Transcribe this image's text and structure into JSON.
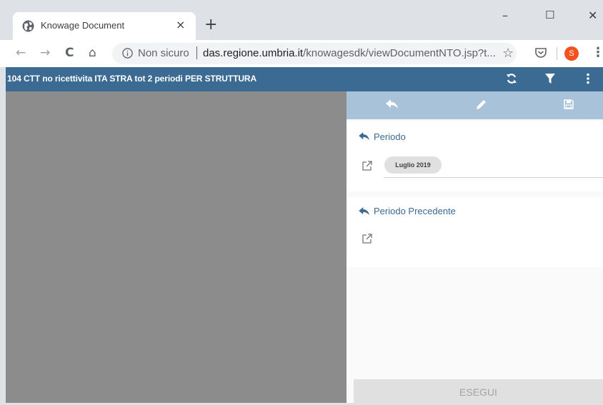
{
  "browser": {
    "tab_title": "Knowage Document",
    "tab_close": "×",
    "new_tab": "+",
    "window_controls": {
      "minimize": "–",
      "maximize": "☐",
      "close": "✕"
    },
    "nav": {
      "back": "←",
      "forward": "→",
      "reload": "C",
      "home": "⌂"
    },
    "security_label": "Non sicuro",
    "url_host": "das.regione.umbria.it",
    "url_path": "/knowagesdk/viewDocumentNTO.jsp?t...",
    "bookmark_star": "☆",
    "profile_initial": "S",
    "menu": "⋮"
  },
  "app": {
    "document_title": "104 CTT no ricettivita ITA STRA tot 2 periodi PER STRUTTURA",
    "header_icons": [
      "refresh-icon",
      "filter-icon",
      "more-vert-icon"
    ],
    "panel_toolbar_icons": [
      "reply-icon",
      "pencil-icon",
      "save-icon"
    ]
  },
  "parameters": [
    {
      "label": "Periodo",
      "value": "Luglio 2019"
    },
    {
      "label": "Periodo Precedente",
      "value": ""
    }
  ],
  "execute_label": "ESEGUI",
  "colors": {
    "header": "#3b6a92",
    "panel_toolbar": "#a8c3d9",
    "grey_area": "#8c8c8c",
    "profile": "#f4511e"
  }
}
